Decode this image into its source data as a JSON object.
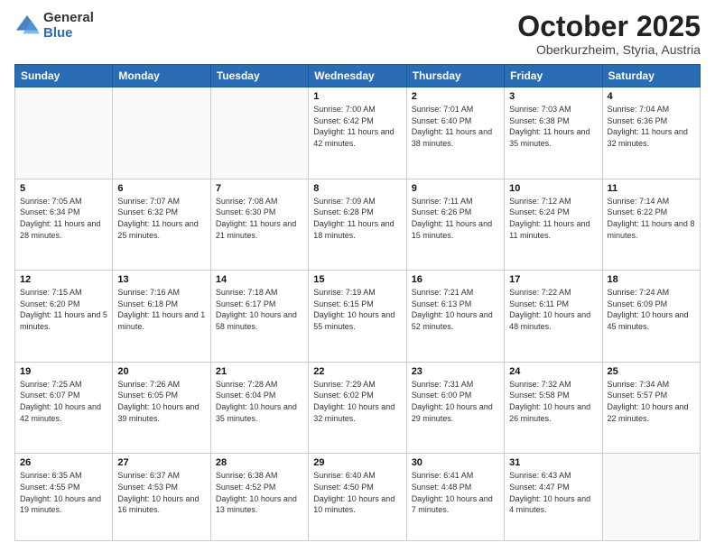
{
  "logo": {
    "general": "General",
    "blue": "Blue"
  },
  "title": {
    "month": "October 2025",
    "location": "Oberkurzheim, Styria, Austria"
  },
  "weekdays": [
    "Sunday",
    "Monday",
    "Tuesday",
    "Wednesday",
    "Thursday",
    "Friday",
    "Saturday"
  ],
  "weeks": [
    [
      {
        "day": "",
        "info": ""
      },
      {
        "day": "",
        "info": ""
      },
      {
        "day": "",
        "info": ""
      },
      {
        "day": "1",
        "info": "Sunrise: 7:00 AM\nSunset: 6:42 PM\nDaylight: 11 hours\nand 42 minutes."
      },
      {
        "day": "2",
        "info": "Sunrise: 7:01 AM\nSunset: 6:40 PM\nDaylight: 11 hours\nand 38 minutes."
      },
      {
        "day": "3",
        "info": "Sunrise: 7:03 AM\nSunset: 6:38 PM\nDaylight: 11 hours\nand 35 minutes."
      },
      {
        "day": "4",
        "info": "Sunrise: 7:04 AM\nSunset: 6:36 PM\nDaylight: 11 hours\nand 32 minutes."
      }
    ],
    [
      {
        "day": "5",
        "info": "Sunrise: 7:05 AM\nSunset: 6:34 PM\nDaylight: 11 hours\nand 28 minutes."
      },
      {
        "day": "6",
        "info": "Sunrise: 7:07 AM\nSunset: 6:32 PM\nDaylight: 11 hours\nand 25 minutes."
      },
      {
        "day": "7",
        "info": "Sunrise: 7:08 AM\nSunset: 6:30 PM\nDaylight: 11 hours\nand 21 minutes."
      },
      {
        "day": "8",
        "info": "Sunrise: 7:09 AM\nSunset: 6:28 PM\nDaylight: 11 hours\nand 18 minutes."
      },
      {
        "day": "9",
        "info": "Sunrise: 7:11 AM\nSunset: 6:26 PM\nDaylight: 11 hours\nand 15 minutes."
      },
      {
        "day": "10",
        "info": "Sunrise: 7:12 AM\nSunset: 6:24 PM\nDaylight: 11 hours\nand 11 minutes."
      },
      {
        "day": "11",
        "info": "Sunrise: 7:14 AM\nSunset: 6:22 PM\nDaylight: 11 hours\nand 8 minutes."
      }
    ],
    [
      {
        "day": "12",
        "info": "Sunrise: 7:15 AM\nSunset: 6:20 PM\nDaylight: 11 hours\nand 5 minutes."
      },
      {
        "day": "13",
        "info": "Sunrise: 7:16 AM\nSunset: 6:18 PM\nDaylight: 11 hours\nand 1 minute."
      },
      {
        "day": "14",
        "info": "Sunrise: 7:18 AM\nSunset: 6:17 PM\nDaylight: 10 hours\nand 58 minutes."
      },
      {
        "day": "15",
        "info": "Sunrise: 7:19 AM\nSunset: 6:15 PM\nDaylight: 10 hours\nand 55 minutes."
      },
      {
        "day": "16",
        "info": "Sunrise: 7:21 AM\nSunset: 6:13 PM\nDaylight: 10 hours\nand 52 minutes."
      },
      {
        "day": "17",
        "info": "Sunrise: 7:22 AM\nSunset: 6:11 PM\nDaylight: 10 hours\nand 48 minutes."
      },
      {
        "day": "18",
        "info": "Sunrise: 7:24 AM\nSunset: 6:09 PM\nDaylight: 10 hours\nand 45 minutes."
      }
    ],
    [
      {
        "day": "19",
        "info": "Sunrise: 7:25 AM\nSunset: 6:07 PM\nDaylight: 10 hours\nand 42 minutes."
      },
      {
        "day": "20",
        "info": "Sunrise: 7:26 AM\nSunset: 6:05 PM\nDaylight: 10 hours\nand 39 minutes."
      },
      {
        "day": "21",
        "info": "Sunrise: 7:28 AM\nSunset: 6:04 PM\nDaylight: 10 hours\nand 35 minutes."
      },
      {
        "day": "22",
        "info": "Sunrise: 7:29 AM\nSunset: 6:02 PM\nDaylight: 10 hours\nand 32 minutes."
      },
      {
        "day": "23",
        "info": "Sunrise: 7:31 AM\nSunset: 6:00 PM\nDaylight: 10 hours\nand 29 minutes."
      },
      {
        "day": "24",
        "info": "Sunrise: 7:32 AM\nSunset: 5:58 PM\nDaylight: 10 hours\nand 26 minutes."
      },
      {
        "day": "25",
        "info": "Sunrise: 7:34 AM\nSunset: 5:57 PM\nDaylight: 10 hours\nand 22 minutes."
      }
    ],
    [
      {
        "day": "26",
        "info": "Sunrise: 6:35 AM\nSunset: 4:55 PM\nDaylight: 10 hours\nand 19 minutes."
      },
      {
        "day": "27",
        "info": "Sunrise: 6:37 AM\nSunset: 4:53 PM\nDaylight: 10 hours\nand 16 minutes."
      },
      {
        "day": "28",
        "info": "Sunrise: 6:38 AM\nSunset: 4:52 PM\nDaylight: 10 hours\nand 13 minutes."
      },
      {
        "day": "29",
        "info": "Sunrise: 6:40 AM\nSunset: 4:50 PM\nDaylight: 10 hours\nand 10 minutes."
      },
      {
        "day": "30",
        "info": "Sunrise: 6:41 AM\nSunset: 4:48 PM\nDaylight: 10 hours\nand 7 minutes."
      },
      {
        "day": "31",
        "info": "Sunrise: 6:43 AM\nSunset: 4:47 PM\nDaylight: 10 hours\nand 4 minutes."
      },
      {
        "day": "",
        "info": ""
      }
    ]
  ]
}
